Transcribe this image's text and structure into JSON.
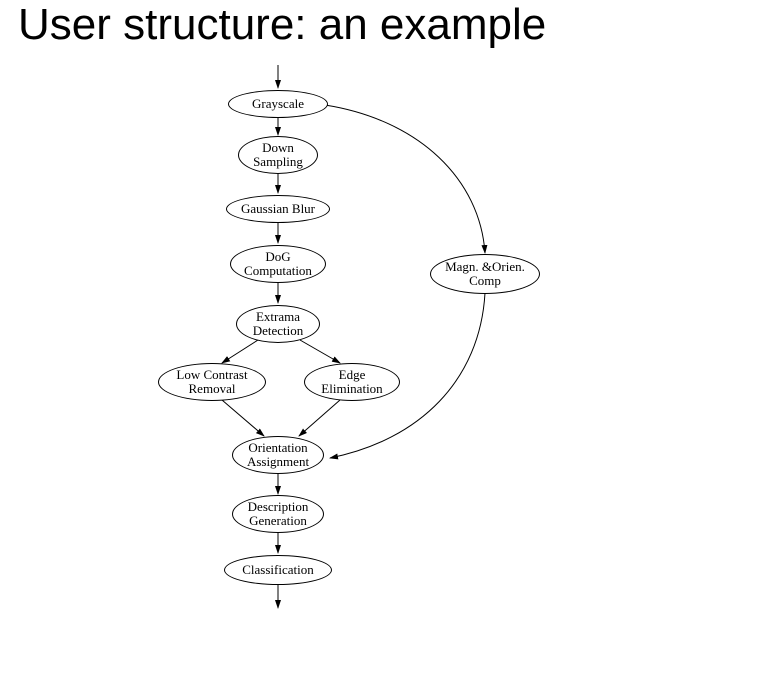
{
  "title": "User structure: an example",
  "nodes": {
    "grayscale": {
      "label": "Grayscale"
    },
    "downsamp": {
      "label": "Down\nSampling"
    },
    "gaussian": {
      "label": "Gaussian Blur"
    },
    "dog": {
      "label": "DoG\nComputation"
    },
    "extrema": {
      "label": "Extrama\nDetection"
    },
    "lowcontrast": {
      "label": "Low Contrast\nRemoval"
    },
    "edge": {
      "label": "Edge\nElimination"
    },
    "orientation": {
      "label": "Orientation\nAssignment"
    },
    "description": {
      "label": "Description\nGeneration"
    },
    "classification": {
      "label": "Classification"
    },
    "magn": {
      "label": "Magn. &Orien.\nComp"
    }
  },
  "edges": [
    {
      "from": "top",
      "to": "grayscale"
    },
    {
      "from": "grayscale",
      "to": "downsamp"
    },
    {
      "from": "downsamp",
      "to": "gaussian"
    },
    {
      "from": "gaussian",
      "to": "dog"
    },
    {
      "from": "dog",
      "to": "extrema"
    },
    {
      "from": "extrema",
      "to": "lowcontrast"
    },
    {
      "from": "extrema",
      "to": "edge"
    },
    {
      "from": "lowcontrast",
      "to": "orientation"
    },
    {
      "from": "edge",
      "to": "orientation"
    },
    {
      "from": "orientation",
      "to": "description"
    },
    {
      "from": "description",
      "to": "classification"
    },
    {
      "from": "classification",
      "to": "bottom"
    },
    {
      "from": "grayscale",
      "to": "magn",
      "curve": "right"
    },
    {
      "from": "magn",
      "to": "orientation",
      "curve": "right"
    }
  ]
}
